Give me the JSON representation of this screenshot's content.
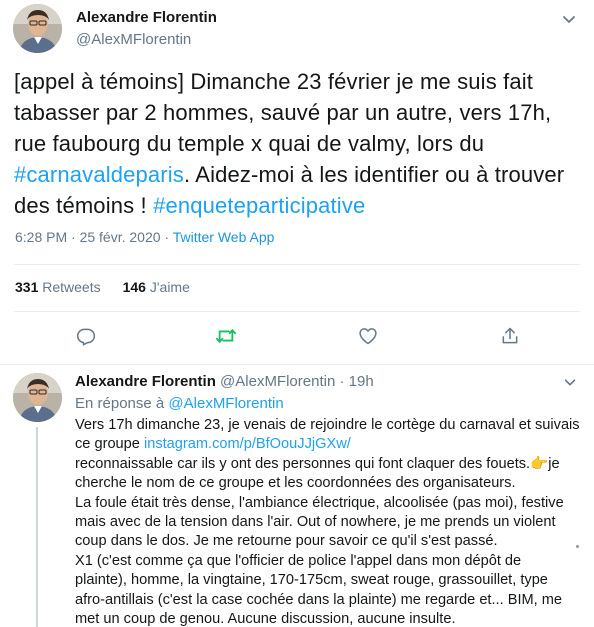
{
  "main": {
    "author_name": "Alexandre Florentin",
    "author_handle": "@AlexMFlorentin",
    "text_lines": [
      [
        "[appel à témoins] Dimanche 23 février je me suis fait",
        ""
      ],
      [
        "tabasser par 2 hommes, sauvé par un autre, vers 17h,",
        ""
      ],
      [
        "rue faubourg du temple x quai de valmy, lors du",
        ""
      ],
      [
        "",
        "#carnavaldeparis",
        ". Aidez-moi à les identifier ou à trouver"
      ],
      [
        "des témoins ! ",
        "#enqueteparticipative"
      ]
    ],
    "text": {
      "l1": "[appel à témoins] Dimanche 23 février je me suis fait",
      "l2": "tabasser par 2 hommes, sauvé par un autre, vers 17h,",
      "l3": "rue faubourg du temple x quai de valmy, lors du",
      "hashtag1": "#carnavaldeparis",
      "l4_rest": ". Aidez-moi à les identifier ou à trouver",
      "l5_start": "des témoins ! ",
      "hashtag2": "#enqueteparticipative"
    },
    "timestamp": "6:28 PM · 25 févr. 2020 · ",
    "source": "Twitter Web App",
    "retweets_count": "331",
    "retweets_label": "Retweets",
    "likes_count": "146",
    "likes_label": "J'aime",
    "actions": [
      "reply-icon",
      "retweet-icon",
      "like-icon",
      "share-icon"
    ]
  },
  "reply": {
    "author_name": "Alexandre Florentin",
    "author_handle": "@AlexMFlorentin",
    "dot": " · ",
    "time": "19h",
    "replying_prefix": "En réponse à ",
    "replying_to": "@AlexMFlorentin",
    "lines": {
      "l1": "Vers 17h dimanche 23, je venais de rejoindre le cortège du carnaval et suivais",
      "l2_start": "ce groupe ",
      "l2_link": "instagram.com/p/BfOouJJjGXw/",
      "l3": "reconnaissable car ils y ont des personnes qui font claquer des fouets.",
      "l3_emoji": "👉",
      "l3_end": "je",
      "l4": "cherche le nom de ce groupe et les coordonnées des organisateurs.",
      "l5": "La foule était très dense, l'ambiance électrique, alcoolisée  (pas moi), festive",
      "l6": "mais avec de la tension dans l'air. Out of nowhere, je me prends un violent",
      "l7": "coup dans le dos. Je me retourne pour savoir ce qu'il s'est passé.",
      "l8": "X1 (c'est comme ça que l'officier de police l'appel dans mon dépôt de",
      "l9": "plainte), homme, la vingtaine, 170-175cm, sweat rouge, grassouillet, type",
      "l10": "afro-antillais (c'est la case cochée dans la plainte) me regarde et... BIM, me",
      "l11": "met un coup de genou. Aucune discussion, aucune insulte."
    }
  },
  "colors": {
    "link": "#1da1f2",
    "secondary": "#657786",
    "retweet_green": "#17bf63",
    "divider": "#e6ecf0"
  }
}
